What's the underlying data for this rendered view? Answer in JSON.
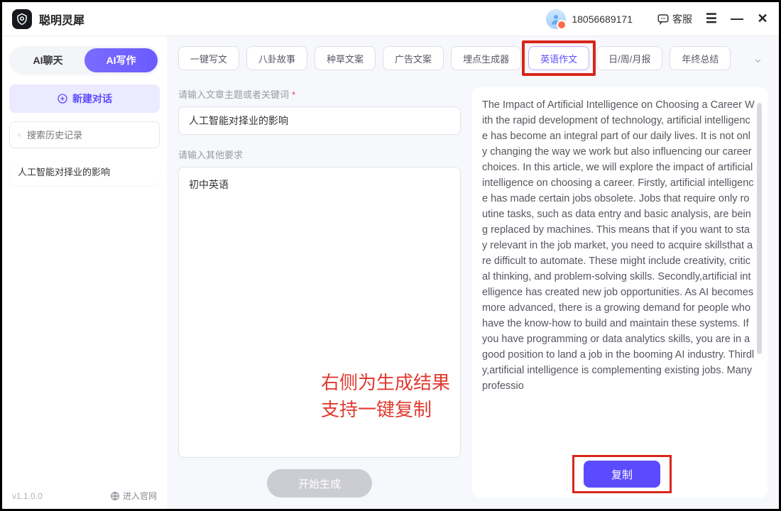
{
  "titlebar": {
    "app_name": "聪明灵犀",
    "phone": "18056689171",
    "support_label": "客服"
  },
  "sidebar": {
    "mode_chat": "AI聊天",
    "mode_write": "AI写作",
    "new_chat": "新建对话",
    "search_placeholder": "搜索历史记录",
    "history": [
      "人工智能对择业的影响"
    ],
    "version": "v1.1.0.0",
    "site_link": "进入官网"
  },
  "tool_tabs": [
    "一键写文",
    "八卦故事",
    "种草文案",
    "广告文案",
    "埋点生成器",
    "英语作文",
    "日/周/月报",
    "年终总结"
  ],
  "active_tool_index": 5,
  "form": {
    "topic_label": "请输入文章主题或者关键词",
    "topic_value": "人工智能对择业的影响",
    "other_label": "请输入其他要求",
    "other_value": "初中英语",
    "generate_label": "开始生成"
  },
  "overlay": {
    "line1": "右侧为生成结果",
    "line2": "支持一键复制"
  },
  "result": {
    "text": "The Impact of Artificial Intelligence on Choosing a Career With the rapid development of technology, artificial intelligence has become an integral part of our daily lives. It is not only changing the way we work but also influencing our career choices. In this article, we will explore the impact of artificial intelligence on choosing a career. Firstly, artificial intelligence has made certain jobs obsolete. Jobs that require only routine tasks, such as data entry and basic analysis, are being replaced by machines. This means that if you want to stay relevant in the job market, you need to acquire skillsthat are difficult to automate. These might include creativity, critical thinking, and problem-solving skills. Secondly,artificial intelligence has created new job opportunities. As AI becomes more advanced, there is a growing demand for people who have the know-how to build and maintain these systems. If you have programming or data analytics skills, you are in a good position to land a job in the booming AI industry. Thirdly,artificial intelligence is complementing existing jobs. Many professio",
    "copy_label": "复制"
  }
}
